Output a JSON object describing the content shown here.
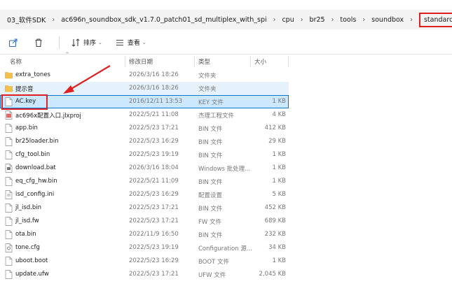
{
  "breadcrumb": {
    "items": [
      "03_软件SDK",
      "ac696n_soundbox_sdk_v1.7.0_patch01_sd_multiplex_with_spi",
      "cpu",
      "br25",
      "tools",
      "soundbox",
      "standard"
    ]
  },
  "toolbar": {
    "sort_label": "排序",
    "view_label": "查看"
  },
  "columns": {
    "name": "名称",
    "date": "修改日期",
    "type": "类型",
    "size": "大小"
  },
  "files": [
    {
      "name": "extra_tones",
      "date": "2026/3/16 18:26",
      "type": "文件夹",
      "size": "",
      "icon": "folder-icon"
    },
    {
      "name": "提示音",
      "date": "2026/3/16 18:26",
      "type": "文件夹",
      "size": "",
      "icon": "folder-icon"
    },
    {
      "name": "AC.key",
      "date": "2016/12/11 13:53",
      "type": "KEY 文件",
      "size": "1 KB",
      "icon": "file-icon"
    },
    {
      "name": "ac696x配置入口.jlxproj",
      "date": "2022/5/21 11:08",
      "type": "杰理工程文件",
      "size": "4 KB",
      "icon": "project-file-icon"
    },
    {
      "name": "app.bin",
      "date": "2022/5/23 17:21",
      "type": "BIN 文件",
      "size": "412 KB",
      "icon": "file-icon"
    },
    {
      "name": "br25loader.bin",
      "date": "2022/5/23 16:29",
      "type": "BIN 文件",
      "size": "29 KB",
      "icon": "file-icon"
    },
    {
      "name": "cfg_tool.bin",
      "date": "2022/5/23 19:19",
      "type": "BIN 文件",
      "size": "1 KB",
      "icon": "file-icon"
    },
    {
      "name": "download.bat",
      "date": "2026/3/16 18:04",
      "type": "Windows 批处理...",
      "size": "1 KB",
      "icon": "batch-file-icon"
    },
    {
      "name": "eq_cfg_hw.bin",
      "date": "2022/5/21 11:09",
      "type": "BIN 文件",
      "size": "1 KB",
      "icon": "file-icon"
    },
    {
      "name": "isd_config.ini",
      "date": "2022/5/23 16:29",
      "type": "配置设置",
      "size": "5 KB",
      "icon": "config-file-icon"
    },
    {
      "name": "jl_isd.bin",
      "date": "2022/5/23 17:21",
      "type": "BIN 文件",
      "size": "452 KB",
      "icon": "file-icon"
    },
    {
      "name": "jl_isd.fw",
      "date": "2022/5/23 17:21",
      "type": "FW 文件",
      "size": "689 KB",
      "icon": "file-icon"
    },
    {
      "name": "ota.bin",
      "date": "2022/11/9 16:50",
      "type": "BIN 文件",
      "size": "232 KB",
      "icon": "file-icon"
    },
    {
      "name": "tone.cfg",
      "date": "2022/5/23 19:19",
      "type": "Configuration 源...",
      "size": "34 KB",
      "icon": "gear-file-icon"
    },
    {
      "name": "uboot.boot",
      "date": "2022/5/23 16:29",
      "type": "BOOT 文件",
      "size": "1 KB",
      "icon": "file-icon"
    },
    {
      "name": "update.ufw",
      "date": "2022/5/23 17:21",
      "type": "UFW 文件",
      "size": "2,045 KB",
      "icon": "file-icon"
    }
  ],
  "colors": {
    "selection_bg": "#cce8ff",
    "selection_border": "#0078d4",
    "annotation_red": "#e02020",
    "folder_yellow": "#f4c04a"
  }
}
